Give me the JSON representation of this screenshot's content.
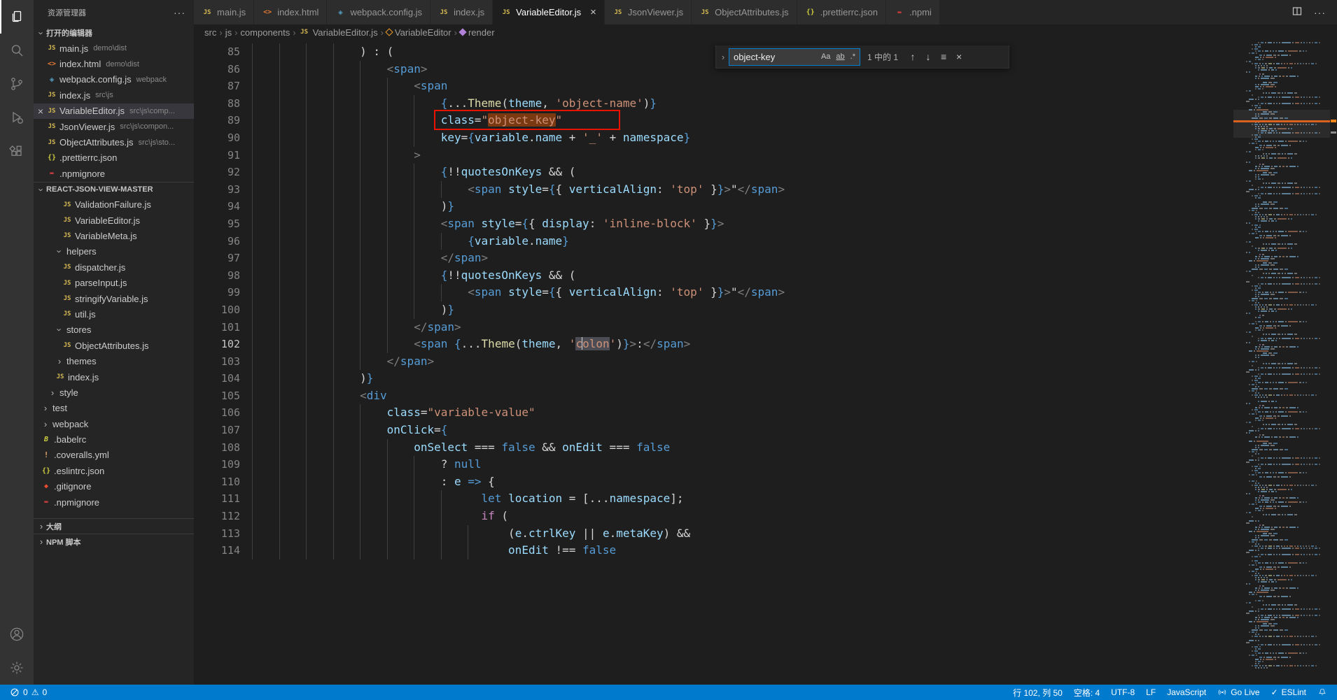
{
  "colors": {
    "status_bar": "#007acc",
    "annotation": "#e51400",
    "find_match": "#ea5c00",
    "accent": "#007fd4"
  },
  "activity_bar": {
    "top": [
      {
        "icon": "files",
        "active": true
      },
      {
        "icon": "search"
      },
      {
        "icon": "source-control"
      },
      {
        "icon": "run-debug"
      },
      {
        "icon": "extensions"
      }
    ],
    "bottom": [
      {
        "icon": "account"
      },
      {
        "icon": "settings"
      }
    ]
  },
  "sidebar": {
    "title": "资源管理器",
    "open_editors_label": "打开的编辑器",
    "project_label": "REACT-JSON-VIEW-MASTER",
    "bottom_sections": [
      "大纲",
      "NPM 脚本"
    ],
    "open_editors": [
      {
        "icon": "js",
        "name": "main.js",
        "detail": "demo\\dist"
      },
      {
        "icon": "html",
        "name": "index.html",
        "detail": "demo\\dist"
      },
      {
        "icon": "webpack",
        "name": "webpack.config.js",
        "detail": "webpack"
      },
      {
        "icon": "js",
        "name": "index.js",
        "detail": "src\\js"
      },
      {
        "icon": "js",
        "name": "VariableEditor.js",
        "detail": "src\\js\\comp...",
        "active": true
      },
      {
        "icon": "js",
        "name": "JsonViewer.js",
        "detail": "src\\js\\compon..."
      },
      {
        "icon": "js",
        "name": "ObjectAttributes.js",
        "detail": "src\\js\\sto..."
      },
      {
        "icon": "json",
        "name": ".prettierrc.json",
        "detail": ""
      },
      {
        "icon": "npm",
        "name": ".npmignore",
        "detail": ""
      }
    ],
    "tree": [
      {
        "kind": "file",
        "icon": "js",
        "name": "ValidationFailure.js",
        "level": 3
      },
      {
        "kind": "file",
        "icon": "js",
        "name": "VariableEditor.js",
        "level": 3
      },
      {
        "kind": "file",
        "icon": "js",
        "name": "VariableMeta.js",
        "level": 3
      },
      {
        "kind": "folder",
        "name": "helpers",
        "level": 2,
        "expanded": true
      },
      {
        "kind": "file",
        "icon": "js",
        "name": "dispatcher.js",
        "level": 3
      },
      {
        "kind": "file",
        "icon": "js",
        "name": "parseInput.js",
        "level": 3
      },
      {
        "kind": "file",
        "icon": "js",
        "name": "stringifyVariable.js",
        "level": 3
      },
      {
        "kind": "file",
        "icon": "js",
        "name": "util.js",
        "level": 3
      },
      {
        "kind": "folder",
        "name": "stores",
        "level": 2,
        "expanded": true
      },
      {
        "kind": "file",
        "icon": "js",
        "name": "ObjectAttributes.js",
        "level": 3
      },
      {
        "kind": "folder",
        "name": "themes",
        "level": 2,
        "expanded": false
      },
      {
        "kind": "file",
        "icon": "js",
        "name": "index.js",
        "level": 2
      },
      {
        "kind": "folder",
        "name": "style",
        "level": 1,
        "expanded": false
      },
      {
        "kind": "folder",
        "name": "test",
        "level": 0,
        "expanded": false
      },
      {
        "kind": "folder",
        "name": "webpack",
        "level": 0,
        "expanded": false
      },
      {
        "kind": "file",
        "icon": "babel",
        "name": ".babelrc",
        "level": 0
      },
      {
        "kind": "file",
        "icon": "warn",
        "name": ".coveralls.yml",
        "level": 0
      },
      {
        "kind": "file",
        "icon": "json",
        "name": ".eslintrc.json",
        "level": 0
      },
      {
        "kind": "file",
        "icon": "git",
        "name": ".gitignore",
        "level": 0
      },
      {
        "kind": "file",
        "icon": "npm",
        "name": ".npmignore",
        "level": 0
      }
    ]
  },
  "tabs": [
    {
      "icon": "js",
      "label": "main.js"
    },
    {
      "icon": "html",
      "label": "index.html"
    },
    {
      "icon": "webpack",
      "label": "webpack.config.js"
    },
    {
      "icon": "js",
      "label": "index.js"
    },
    {
      "icon": "js",
      "label": "VariableEditor.js",
      "active": true,
      "close_glyph": "×"
    },
    {
      "icon": "js",
      "label": "JsonViewer.js"
    },
    {
      "icon": "js",
      "label": "ObjectAttributes.js"
    },
    {
      "icon": "json",
      "label": ".prettierrc.json"
    },
    {
      "icon": "npm",
      "label": ".npmi",
      "truncated": true
    }
  ],
  "breadcrumbs": [
    {
      "label": "src"
    },
    {
      "label": "js"
    },
    {
      "label": "components"
    },
    {
      "label": "VariableEditor.js",
      "icon": "js"
    },
    {
      "label": "VariableEditor",
      "icon": "class"
    },
    {
      "label": "render",
      "icon": "method"
    }
  ],
  "find": {
    "query": "object-key",
    "matches": "1 中的 1",
    "case_label": "Aa",
    "word_label": "ab",
    "regex_label": ".*"
  },
  "editor": {
    "annotation": {
      "line": 89,
      "target": "class=\"object-key\""
    },
    "lines": [
      {
        "n": 85,
        "i": 16,
        "t": [
          [
            "p",
            ") : ("
          ]
        ]
      },
      {
        "n": 86,
        "i": 20,
        "t": [
          [
            "g",
            "<"
          ],
          [
            "b",
            "span"
          ],
          [
            "g",
            ">"
          ]
        ]
      },
      {
        "n": 87,
        "i": 24,
        "t": [
          [
            "g",
            "<"
          ],
          [
            "b",
            "span"
          ]
        ]
      },
      {
        "n": 88,
        "i": 28,
        "t": [
          [
            "b",
            "{"
          ],
          [
            "p",
            "..."
          ],
          [
            "y",
            "Theme"
          ],
          [
            "p",
            "("
          ],
          [
            "lb",
            "theme"
          ],
          [
            "p",
            ", "
          ],
          [
            "o",
            "'object-name'"
          ],
          [
            "p",
            ")"
          ],
          [
            "b",
            "}"
          ]
        ]
      },
      {
        "n": 89,
        "i": 28,
        "box": true,
        "t": [
          [
            "lb",
            "class"
          ],
          [
            "p",
            "="
          ],
          [
            "o",
            "\""
          ],
          [
            "o",
            "object-key",
            "find"
          ],
          [
            "o",
            "\""
          ]
        ]
      },
      {
        "n": 90,
        "i": 28,
        "t": [
          [
            "lb",
            "key"
          ],
          [
            "p",
            "="
          ],
          [
            "b",
            "{"
          ],
          [
            "lb",
            "variable"
          ],
          [
            "p",
            "."
          ],
          [
            "lb",
            "name"
          ],
          [
            "p",
            " + "
          ],
          [
            "o",
            "'_'"
          ],
          [
            "p",
            " + "
          ],
          [
            "lb",
            "namespace"
          ],
          [
            "b",
            "}"
          ]
        ]
      },
      {
        "n": 91,
        "i": 24,
        "t": [
          [
            "g",
            ">"
          ]
        ]
      },
      {
        "n": 92,
        "i": 28,
        "t": [
          [
            "b",
            "{"
          ],
          [
            "p",
            "!!"
          ],
          [
            "lb",
            "quotesOnKeys"
          ],
          [
            "p",
            " && ("
          ]
        ]
      },
      {
        "n": 93,
        "i": 32,
        "t": [
          [
            "g",
            "<"
          ],
          [
            "b",
            "span"
          ],
          [
            "p",
            " "
          ],
          [
            "lb",
            "style"
          ],
          [
            "p",
            "="
          ],
          [
            "b",
            "{"
          ],
          [
            "p",
            "{ "
          ],
          [
            "lb",
            "verticalAlign"
          ],
          [
            "p",
            ": "
          ],
          [
            "o",
            "'top'"
          ],
          [
            "p",
            " }"
          ],
          [
            "b",
            "}"
          ],
          [
            "g",
            ">"
          ],
          [
            "p",
            "\""
          ],
          [
            "g",
            "</"
          ],
          [
            "b",
            "span"
          ],
          [
            "g",
            ">"
          ]
        ]
      },
      {
        "n": 94,
        "i": 28,
        "t": [
          [
            "p",
            ")"
          ],
          [
            "b",
            "}"
          ]
        ]
      },
      {
        "n": 95,
        "i": 28,
        "t": [
          [
            "g",
            "<"
          ],
          [
            "b",
            "span"
          ],
          [
            "p",
            " "
          ],
          [
            "lb",
            "style"
          ],
          [
            "p",
            "="
          ],
          [
            "b",
            "{"
          ],
          [
            "p",
            "{ "
          ],
          [
            "lb",
            "display"
          ],
          [
            "p",
            ": "
          ],
          [
            "o",
            "'inline-block'"
          ],
          [
            "p",
            " }"
          ],
          [
            "b",
            "}"
          ],
          [
            "g",
            ">"
          ]
        ]
      },
      {
        "n": 96,
        "i": 32,
        "t": [
          [
            "b",
            "{"
          ],
          [
            "lb",
            "variable"
          ],
          [
            "p",
            "."
          ],
          [
            "lb",
            "name"
          ],
          [
            "b",
            "}"
          ]
        ]
      },
      {
        "n": 97,
        "i": 28,
        "t": [
          [
            "g",
            "</"
          ],
          [
            "b",
            "span"
          ],
          [
            "g",
            ">"
          ]
        ]
      },
      {
        "n": 98,
        "i": 28,
        "t": [
          [
            "b",
            "{"
          ],
          [
            "p",
            "!!"
          ],
          [
            "lb",
            "quotesOnKeys"
          ],
          [
            "p",
            " && ("
          ]
        ]
      },
      {
        "n": 99,
        "i": 32,
        "t": [
          [
            "g",
            "<"
          ],
          [
            "b",
            "span"
          ],
          [
            "p",
            " "
          ],
          [
            "lb",
            "style"
          ],
          [
            "p",
            "="
          ],
          [
            "b",
            "{"
          ],
          [
            "p",
            "{ "
          ],
          [
            "lb",
            "verticalAlign"
          ],
          [
            "p",
            ": "
          ],
          [
            "o",
            "'top'"
          ],
          [
            "p",
            " }"
          ],
          [
            "b",
            "}"
          ],
          [
            "g",
            ">"
          ],
          [
            "p",
            "\""
          ],
          [
            "g",
            "</"
          ],
          [
            "b",
            "span"
          ],
          [
            "g",
            ">"
          ]
        ]
      },
      {
        "n": 100,
        "i": 28,
        "t": [
          [
            "p",
            ")"
          ],
          [
            "b",
            "}"
          ]
        ]
      },
      {
        "n": 101,
        "i": 24,
        "t": [
          [
            "g",
            "</"
          ],
          [
            "b",
            "span"
          ],
          [
            "g",
            ">"
          ]
        ]
      },
      {
        "n": 102,
        "i": 24,
        "active": true,
        "t": [
          [
            "g",
            "<"
          ],
          [
            "b",
            "span"
          ],
          [
            "p",
            " "
          ],
          [
            "b",
            "{"
          ],
          [
            "p",
            "..."
          ],
          [
            "y",
            "Theme"
          ],
          [
            "p",
            "("
          ],
          [
            "lb",
            "theme"
          ],
          [
            "p",
            ", "
          ],
          [
            "o",
            "'"
          ],
          [
            "wh",
            "c"
          ],
          [
            "caret",
            ""
          ],
          [
            "wh",
            "olon"
          ],
          [
            "o",
            "'"
          ],
          [
            "p",
            ")"
          ],
          [
            "b",
            "}"
          ],
          [
            "g",
            ">"
          ],
          [
            "p",
            ":"
          ],
          [
            "g",
            "</"
          ],
          [
            "b",
            "span"
          ],
          [
            "g",
            ">"
          ]
        ]
      },
      {
        "n": 103,
        "i": 20,
        "t": [
          [
            "g",
            "</"
          ],
          [
            "b",
            "span"
          ],
          [
            "g",
            ">"
          ]
        ]
      },
      {
        "n": 104,
        "i": 16,
        "t": [
          [
            "p",
            ")"
          ],
          [
            "b",
            "}"
          ]
        ]
      },
      {
        "n": 105,
        "i": 16,
        "t": [
          [
            "g",
            "<"
          ],
          [
            "b",
            "div"
          ]
        ]
      },
      {
        "n": 106,
        "i": 20,
        "t": [
          [
            "lb",
            "class"
          ],
          [
            "p",
            "="
          ],
          [
            "o",
            "\"variable-value\""
          ]
        ]
      },
      {
        "n": 107,
        "i": 20,
        "t": [
          [
            "lb",
            "onClick"
          ],
          [
            "p",
            "="
          ],
          [
            "b",
            "{"
          ]
        ]
      },
      {
        "n": 108,
        "i": 24,
        "t": [
          [
            "lb",
            "onSelect"
          ],
          [
            "p",
            " === "
          ],
          [
            "b",
            "false"
          ],
          [
            "p",
            " && "
          ],
          [
            "lb",
            "onEdit"
          ],
          [
            "p",
            " === "
          ],
          [
            "b",
            "false"
          ]
        ]
      },
      {
        "n": 109,
        "i": 28,
        "t": [
          [
            "p",
            "? "
          ],
          [
            "b",
            "null"
          ]
        ]
      },
      {
        "n": 110,
        "i": 28,
        "t": [
          [
            "p",
            ": "
          ],
          [
            "lb",
            "e"
          ],
          [
            "p",
            " "
          ],
          [
            "b",
            "=>"
          ],
          [
            "p",
            " {"
          ]
        ]
      },
      {
        "n": 111,
        "i": 34,
        "t": [
          [
            "b",
            "let"
          ],
          [
            "p",
            " "
          ],
          [
            "lb",
            "location"
          ],
          [
            "p",
            " = ["
          ],
          [
            "p",
            "..."
          ],
          [
            "lb",
            "namespace"
          ],
          [
            "p",
            "];"
          ]
        ]
      },
      {
        "n": 112,
        "i": 34,
        "t": [
          [
            "m",
            "if"
          ],
          [
            "p",
            " ("
          ]
        ]
      },
      {
        "n": 113,
        "i": 38,
        "t": [
          [
            "p",
            "("
          ],
          [
            "lb",
            "e"
          ],
          [
            "p",
            "."
          ],
          [
            "lb",
            "ctrlKey"
          ],
          [
            "p",
            " || "
          ],
          [
            "lb",
            "e"
          ],
          [
            "p",
            "."
          ],
          [
            "lb",
            "metaKey"
          ],
          [
            "p",
            ") &&"
          ]
        ]
      },
      {
        "n": 114,
        "i": 38,
        "t": [
          [
            "lb",
            "onEdit"
          ],
          [
            "p",
            " !== "
          ],
          [
            "b",
            "false"
          ]
        ]
      }
    ]
  },
  "status_bar": {
    "errors": "0",
    "warnings": "0",
    "cursor": "行 102, 列 50",
    "indent": "空格: 4",
    "encoding": "UTF-8",
    "eol": "LF",
    "language": "JavaScript",
    "golive": "Go Live",
    "eslint": "ESLint",
    "eslint_check": "✓",
    "warning_glyph": "⚠"
  }
}
